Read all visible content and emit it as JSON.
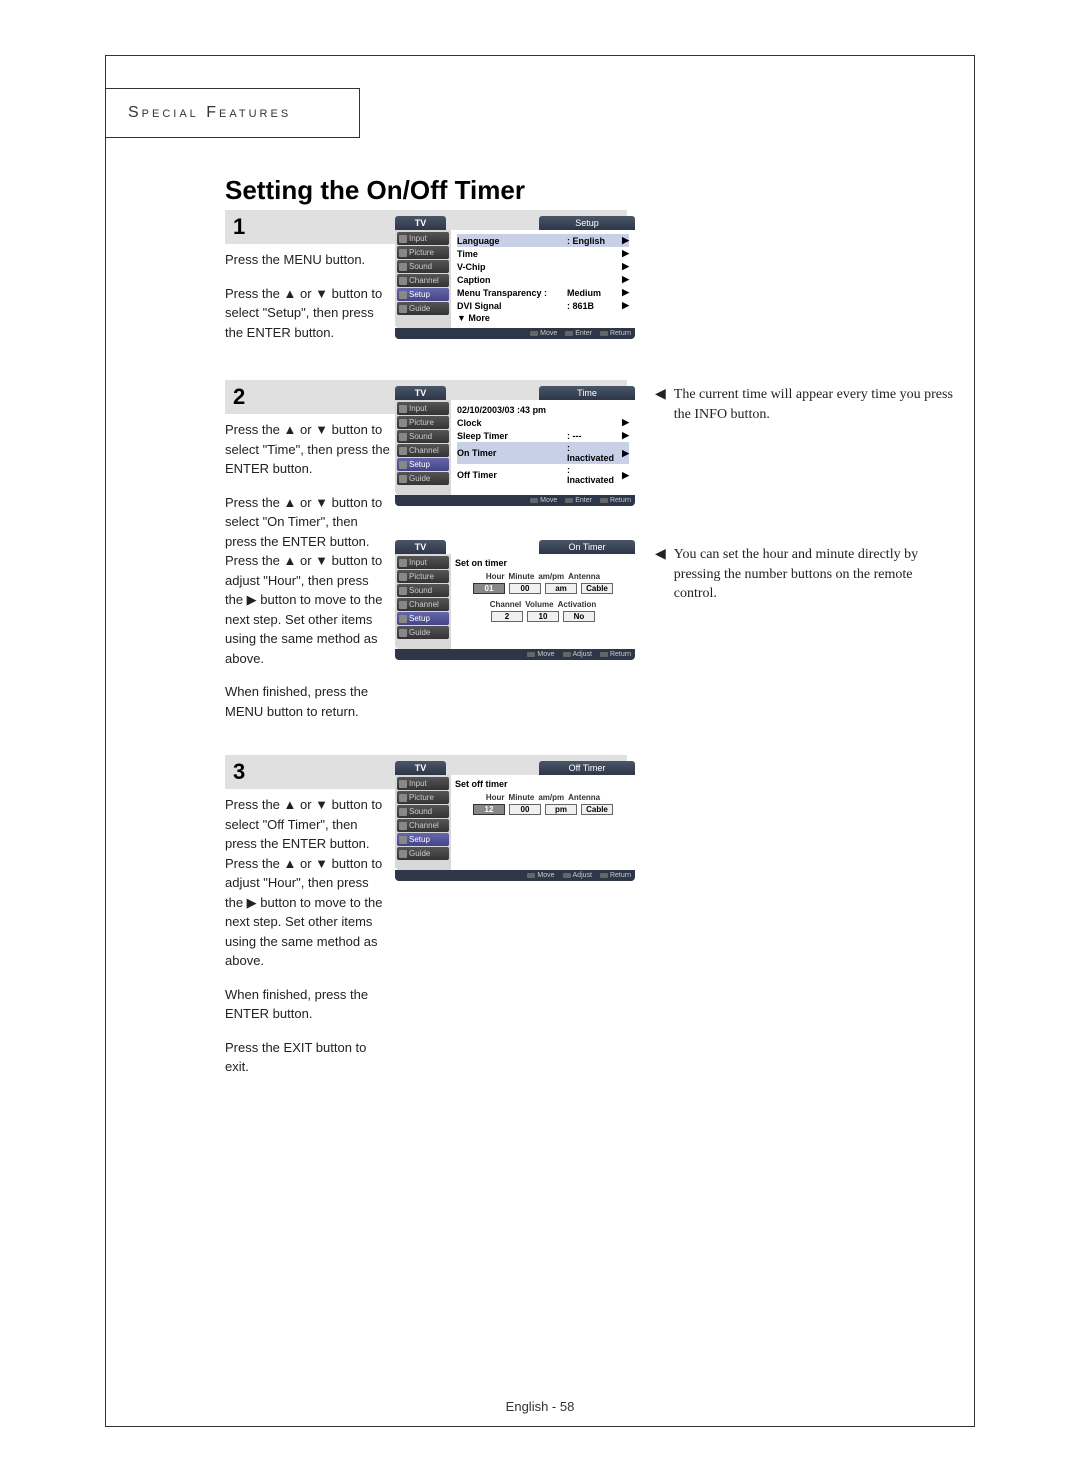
{
  "header": "Special Features",
  "title": "Setting the On/Off Timer",
  "footer": "English - 58",
  "steps": {
    "s1": {
      "num": "1",
      "p1": "Press the MENU button.",
      "p2": "Press the ▲ or ▼ button to select \"Setup\", then press the ENTER button.",
      "osd": {
        "tv": "TV",
        "panel": "Setup",
        "side": [
          "Input",
          "Picture",
          "Sound",
          "Channel",
          "Setup",
          "Guide"
        ],
        "rows": [
          {
            "lbl": "Language",
            "val": ": English",
            "arr": "▶",
            "sel": true
          },
          {
            "lbl": "Time",
            "val": "",
            "arr": "▶"
          },
          {
            "lbl": "V-Chip",
            "val": "",
            "arr": "▶"
          },
          {
            "lbl": "Caption",
            "val": "",
            "arr": "▶"
          },
          {
            "lbl": "Menu Transparency :",
            "val": "Medium",
            "arr": "▶"
          },
          {
            "lbl": "DVI Signal",
            "val": ": 861B",
            "arr": "▶"
          },
          {
            "lbl": "▼ More",
            "val": "",
            "arr": ""
          }
        ],
        "footer": [
          "Move",
          "Enter",
          "Return"
        ]
      }
    },
    "s2": {
      "num": "2",
      "p1": "Press the ▲ or ▼ button to select \"Time\", then press the ENTER button.",
      "p2": "Press the ▲ or ▼ button to select \"On Timer\", then press the ENTER button. Press the ▲ or ▼ button to adjust \"Hour\", then press the ▶ button to move to the next step. Set other items using the same method as above.",
      "p3": "When finished, press the MENU button to return.",
      "osd_time": {
        "tv": "TV",
        "panel": "Time",
        "side": [
          "Input",
          "Picture",
          "Sound",
          "Channel",
          "Setup",
          "Guide"
        ],
        "datetime": "02/10/2003/03 :43 pm",
        "rows": [
          {
            "lbl": "Clock",
            "val": "",
            "arr": "▶"
          },
          {
            "lbl": "Sleep Timer",
            "val": ": ---",
            "arr": "▶"
          },
          {
            "lbl": "On Timer",
            "val": ": Inactivated",
            "arr": "▶",
            "sel": true
          },
          {
            "lbl": "Off Timer",
            "val": ": Inactivated",
            "arr": "▶"
          }
        ],
        "footer": [
          "Move",
          "Enter",
          "Return"
        ]
      },
      "osd_on": {
        "tv": "TV",
        "panel": "On Timer",
        "side": [
          "Input",
          "Picture",
          "Sound",
          "Channel",
          "Setup",
          "Guide"
        ],
        "title": "Set on timer",
        "hdr": [
          "Hour",
          "Minute",
          "am/pm",
          "Antenna"
        ],
        "row1": [
          "01",
          "00",
          "am",
          "Cable"
        ],
        "hdr2": [
          "Channel",
          "Volume",
          "Activation"
        ],
        "row2": [
          "2",
          "10",
          "No"
        ],
        "footer": [
          "Move",
          "Adjust",
          "Return"
        ]
      },
      "note1": "The current time will appear every time you press the INFO button.",
      "note2": "You can set the hour and minute directly by pressing the number buttons on the remote control."
    },
    "s3": {
      "num": "3",
      "p1": "Press the ▲ or ▼ button to select \"Off Timer\", then press the ENTER button. Press the ▲ or ▼ button to adjust \"Hour\", then press the ▶ button to move to the next step. Set other items using the same method as above.",
      "p2": "When finished, press the ENTER button.",
      "p3": "Press the EXIT button to exit.",
      "osd_off": {
        "tv": "TV",
        "panel": "Off Timer",
        "side": [
          "Input",
          "Picture",
          "Sound",
          "Channel",
          "Setup",
          "Guide"
        ],
        "title": "Set off timer",
        "hdr": [
          "Hour",
          "Minute",
          "am/pm",
          "Antenna"
        ],
        "row1": [
          "12",
          "00",
          "pm",
          "Cable"
        ],
        "footer": [
          "Move",
          "Adjust",
          "Return"
        ]
      }
    }
  }
}
